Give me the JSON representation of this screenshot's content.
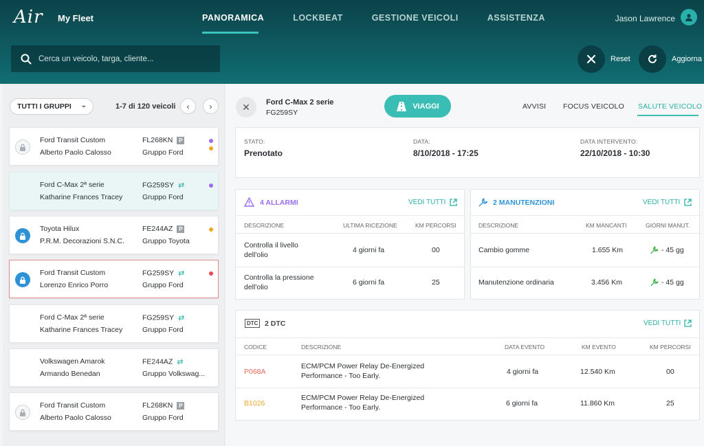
{
  "header": {
    "logo": "Air",
    "app_name": "My Fleet",
    "nav": [
      "PANORAMICA",
      "LOCKBEAT",
      "GESTIONE VEICOLI",
      "ASSISTENZA"
    ],
    "active_nav": "PANORAMICA",
    "user_name": "Jason Lawrence"
  },
  "search": {
    "placeholder": "Cerca un veicolo, targa, cliente..."
  },
  "actions": {
    "reset_label": "Reset",
    "refresh_label": "Aggiorna"
  },
  "list": {
    "group_filter": "TUTTI I GRUPPI",
    "count": "1-7 di 120 veicoli",
    "vehicles": [
      {
        "model": "Ford Transit Custom",
        "owner": "Alberto Paolo Calosso",
        "plate": "FL268KN",
        "group": "Gruppo Ford",
        "tag": "P",
        "lock": "grey",
        "dots": [
          "#9b6cf0",
          "#f3a71c"
        ]
      },
      {
        "model": "Ford C-Max 2ª serie",
        "owner": "Katharine Frances Tracey",
        "plate": "FG259SY",
        "group": "Gruppo Ford",
        "tag": "swap",
        "lock": "none",
        "dots": [
          "#9b6cf0"
        ],
        "selected": true
      },
      {
        "model": "Toyota Hilux",
        "owner": "P.R.M. Decorazioni S.N.C.",
        "plate": "FE244AZ",
        "group": "Gruppo Toyota",
        "tag": "P",
        "lock": "blue",
        "dots": [
          "#f3a71c"
        ]
      },
      {
        "model": "Ford Transit Custom",
        "owner": "Lorenzo Enrico Porro",
        "plate": "FG259SY",
        "group": "Gruppo Ford",
        "tag": "swap",
        "lock": "blue",
        "dots": [
          "#e94b4b"
        ],
        "alert": true
      },
      {
        "model": "Ford C-Max 2ª serie",
        "owner": "Katharine Frances Tracey",
        "plate": "FG259SY",
        "group": "Gruppo Ford",
        "tag": "swap",
        "lock": "none",
        "dots": []
      },
      {
        "model": "Volkswagen Amarok",
        "owner": "Armando Benedan",
        "plate": "FE244AZ",
        "group": "Gruppo Volkswag...",
        "tag": "swap",
        "lock": "none",
        "dots": []
      },
      {
        "model": "Ford Transit Custom",
        "owner": "Alberto Paolo Calosso",
        "plate": "FL268KN",
        "group": "Gruppo Ford",
        "tag": "P",
        "lock": "grey",
        "dots": []
      }
    ]
  },
  "detail": {
    "title": "Ford C-Max 2 serie",
    "plate": "FG259SY",
    "viaggi_label": "VIAGGI",
    "tabs": [
      "AVVISI",
      "FOCUS VEICOLO",
      "SALUTE VEICOLO"
    ],
    "active_tab": "SALUTE VEICOLO",
    "status": {
      "stato_label": "STATO:",
      "stato": "Prenotato",
      "data_label": "DATA:",
      "data": "8/10/2018 - 17:25",
      "intervento_label": "DATA INTERVENTO:",
      "intervento": "22/10/2018 - 10:30"
    },
    "alarms": {
      "title": "4 ALLARMI",
      "see_all": "VEDI TUTTI",
      "columns": [
        "DESCRIZIONE",
        "ULTIMA RICEZIONE",
        "KM PERCORSI"
      ],
      "rows": [
        [
          "Controlla il livello dell'olio",
          "4 giorni fa",
          "00"
        ],
        [
          "Controlla la pressione dell'olio",
          "6 giorni fa",
          "25"
        ]
      ]
    },
    "maintenance": {
      "title": "2 MANUTENZIONI",
      "see_all": "VEDI TUTTI",
      "columns": [
        "DESCRIZIONE",
        "KM MANCANTI",
        "GIORNI MANUT."
      ],
      "rows": [
        [
          "Cambio gomme",
          "1.655 Km",
          "- 45 gg"
        ],
        [
          "Manutenzione ordinaria",
          "3.456 Km",
          "- 45 gg"
        ]
      ]
    },
    "dtc": {
      "badge": "DTC",
      "title": "2 DTC",
      "see_all": "VEDI TUTTI",
      "columns": [
        "CODICE",
        "DESCRIZIONE",
        "DATA EVENTO",
        "KM EVENTO",
        "KM PERCORSI"
      ],
      "rows": [
        {
          "code": "P068A",
          "code_color": "#e86a5a",
          "desc": "ECM/PCM Power Relay De-Energized Performance - Too Early.",
          "date": "4 giorni fa",
          "km_event": "12.540 Km",
          "km": "00"
        },
        {
          "code": "B1026",
          "code_color": "#f0a830",
          "desc": "ECM/PCM Power Relay De-Energized Performance - Too Early.",
          "date": "6 giorni fa",
          "km_event": "11.860 Km",
          "km": "25"
        }
      ]
    }
  },
  "colors": {
    "accent": "#39bdb4",
    "alarm": "#9b6cf0",
    "maintenance": "#2e93d6",
    "lock": "#2e93d6"
  }
}
